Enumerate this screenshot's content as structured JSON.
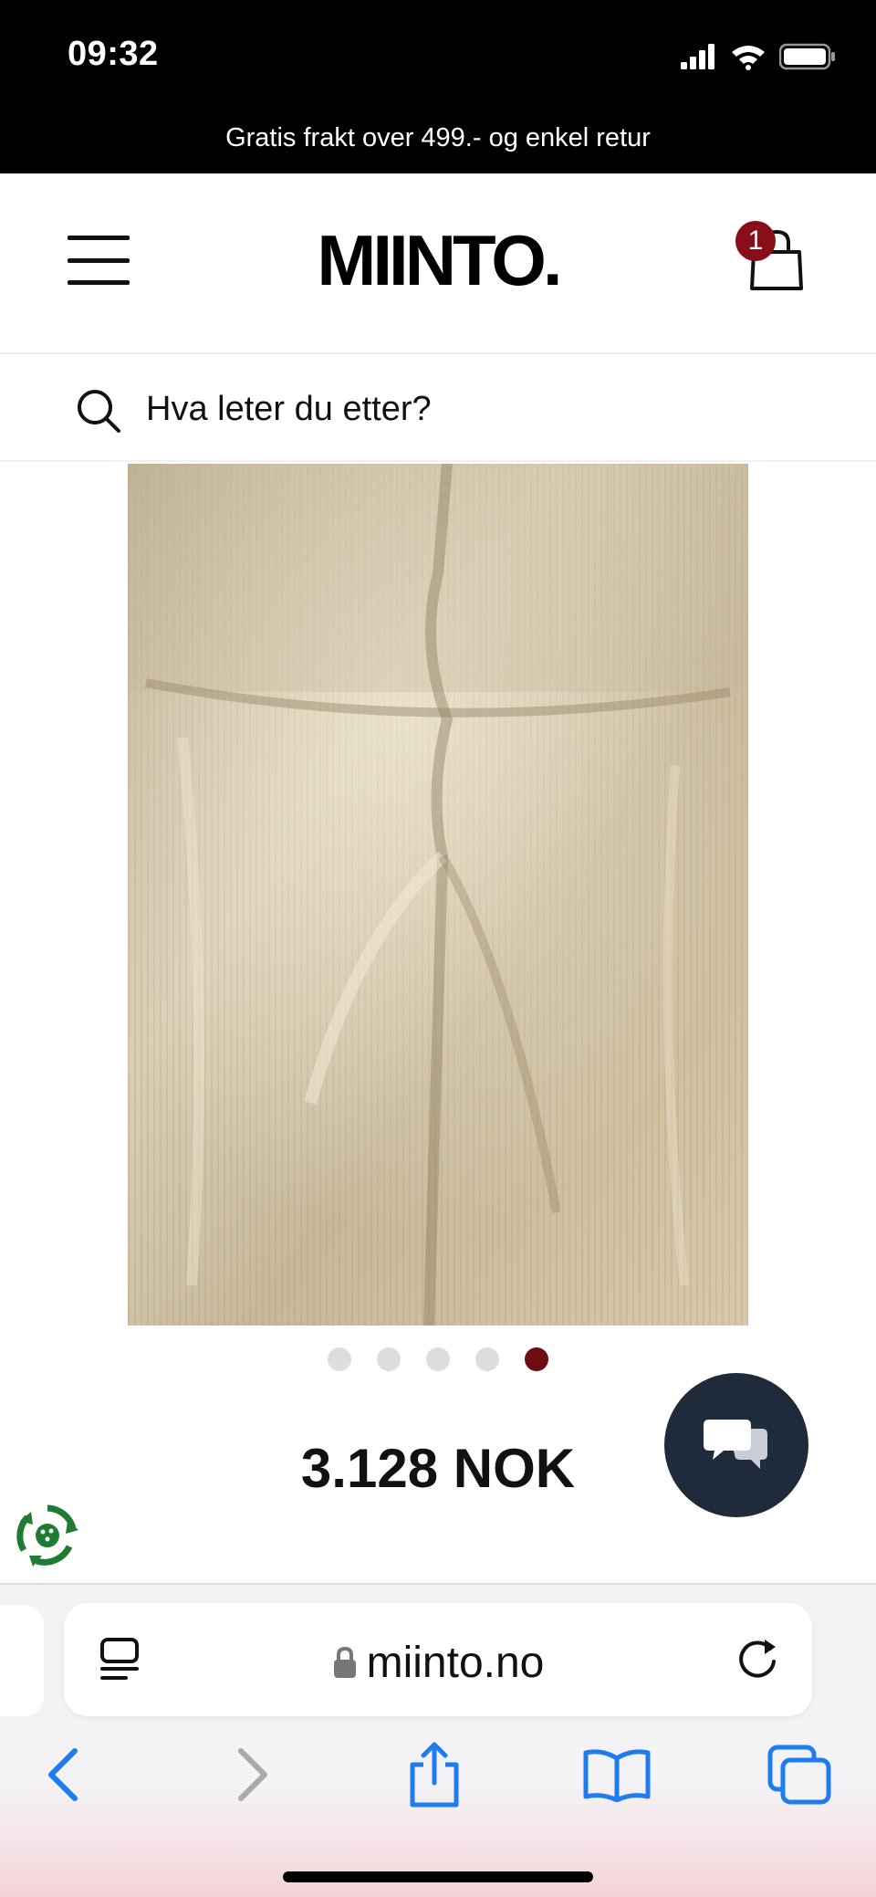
{
  "status_bar": {
    "time": "09:32",
    "icons": [
      "cellular-signal-icon",
      "wifi-icon",
      "battery-icon"
    ]
  },
  "promo_banner": {
    "text": "Gratis frakt over 499.- og enkel retur"
  },
  "header": {
    "logo": "MIINTO.",
    "menu_icon": "hamburger-menu-icon",
    "cart_icon": "shopping-bag-icon",
    "cart_count": "1"
  },
  "search": {
    "placeholder": "Hva leter du etter?",
    "value": "",
    "icon": "search-icon"
  },
  "product": {
    "image_alt": "",
    "carousel": {
      "total": 5,
      "active_index": 4
    },
    "price": "3.128 NOK"
  },
  "chat": {
    "icon": "chat-bubbles-icon"
  },
  "eco": {
    "icon": "recycle-badge-icon"
  },
  "browser": {
    "url": "miinto.no",
    "toolbar": [
      "back-icon",
      "forward-icon",
      "share-icon",
      "bookmarks-icon",
      "tabs-icon"
    ]
  },
  "colors": {
    "accent": "#6e0b13",
    "badge": "#8a0e1a",
    "chat_bg": "#1f2a3a",
    "ios_blue": "#1f7cf0",
    "eco_green": "#1f7a32"
  }
}
